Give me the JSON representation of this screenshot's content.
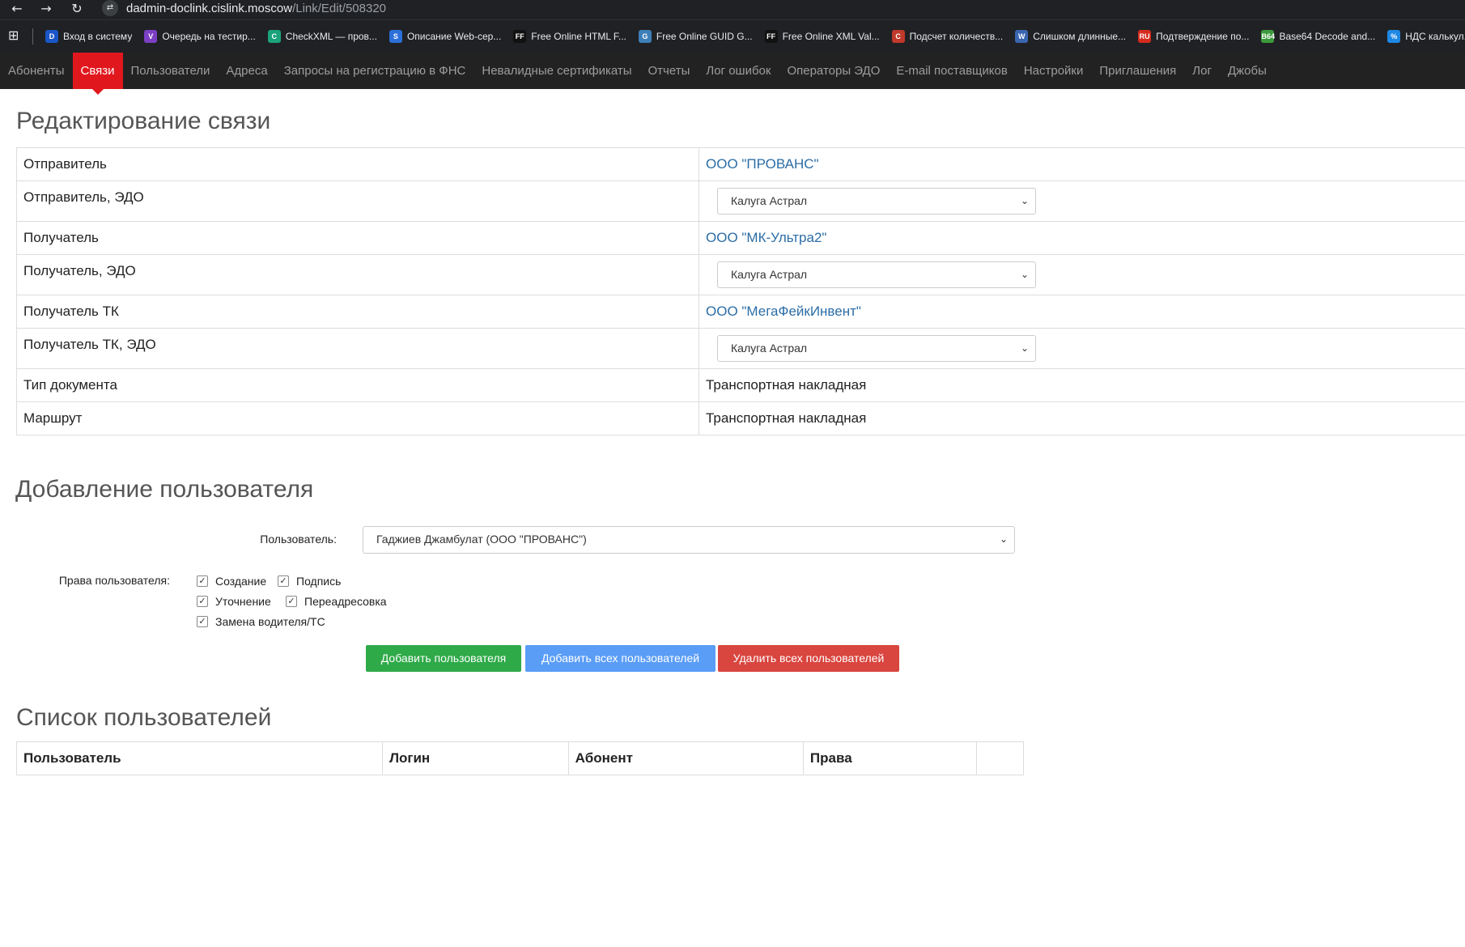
{
  "browser": {
    "back_glyph": "←",
    "forward_glyph": "→",
    "reload_glyph": "↻",
    "site_glyph": "⇄",
    "url_host": "dadmin-doclink.cislink.moscow",
    "url_path": "/Link/Edit/508320",
    "apps_glyph": "⊞",
    "bookmarks": [
      {
        "label": "Вход в систему",
        "icon": "D",
        "color": "#1a56c7"
      },
      {
        "label": "Очередь на тестир...",
        "icon": "V",
        "color": "#7b3fc4"
      },
      {
        "label": "CheckXML — пров...",
        "icon": "C",
        "color": "#1aa37a"
      },
      {
        "label": "Описание Web-сер...",
        "icon": "S",
        "color": "#2b6fd9"
      },
      {
        "label": "Free Online HTML F...",
        "icon": "FF",
        "color": "#111111"
      },
      {
        "label": "Free Online GUID G...",
        "icon": "G",
        "color": "#3d7fb8"
      },
      {
        "label": "Free Online XML Val...",
        "icon": "FF",
        "color": "#111111"
      },
      {
        "label": "Подсчет количеств...",
        "icon": "C",
        "color": "#c0392b"
      },
      {
        "label": "Слишком длинные...",
        "icon": "W",
        "color": "#3a66b0"
      },
      {
        "label": "Подтверждение по...",
        "icon": "RU",
        "color": "#d52b1e"
      },
      {
        "label": "Base64 Decode and...",
        "icon": "B64",
        "color": "#3c9a3c"
      },
      {
        "label": "НДС калькул...",
        "icon": "%",
        "color": "#1e88e5"
      }
    ]
  },
  "nav": {
    "items": [
      "Абоненты",
      "Связи",
      "Пользователи",
      "Адреса",
      "Запросы на регистрацию в ФНС",
      "Невалидные сертификаты",
      "Отчеты",
      "Лог ошибок",
      "Операторы ЭДО",
      "E-mail поставщиков",
      "Настройки",
      "Приглашения",
      "Лог",
      "Джобы"
    ],
    "active": "Связи"
  },
  "edit": {
    "title": "Редактирование связи",
    "rows": [
      {
        "label": "Отправитель",
        "value": "ООО \"ПРОВАНС\"",
        "kind": "link"
      },
      {
        "label": "Отправитель, ЭДО",
        "value": "Калуга Астрал",
        "kind": "select"
      },
      {
        "label": "Получатель",
        "value": "ООО \"МК-Ультра2\"",
        "kind": "link"
      },
      {
        "label": "Получатель, ЭДО",
        "value": "Калуга Астрал",
        "kind": "select"
      },
      {
        "label": "Получатель ТК",
        "value": "ООО \"МегаФейкИнвент\"",
        "kind": "link"
      },
      {
        "label": "Получатель ТК, ЭДО",
        "value": "Калуга Астрал",
        "kind": "select"
      },
      {
        "label": "Тип документа",
        "value": "Транспортная накладная",
        "kind": "text"
      },
      {
        "label": "Маршрут",
        "value": "Транспортная накладная",
        "kind": "text"
      }
    ],
    "chevron": "⌄"
  },
  "add_user": {
    "title": "Добавление пользователя",
    "user_label": "Пользователь:",
    "user_value": "Гаджиев Джамбулат (ООО \"ПРОВАНС\")",
    "rights_label": "Права пользователя:",
    "check_glyph": "✓",
    "rights": [
      {
        "label": "Создание",
        "checked": true
      },
      {
        "label": "Подпись",
        "checked": true
      },
      {
        "label": "Уточнение",
        "checked": true
      },
      {
        "label": "Переадресовка",
        "checked": true
      },
      {
        "label": "Замена водителя/ТС",
        "checked": true
      }
    ],
    "btn_add": "Добавить пользователя",
    "btn_add_all": "Добавить всех пользователей",
    "btn_delete_all": "Удалить всех пользователей"
  },
  "users_list": {
    "title": "Список пользователей",
    "columns": [
      "Пользователь",
      "Логин",
      "Абонент",
      "Права",
      ""
    ]
  }
}
